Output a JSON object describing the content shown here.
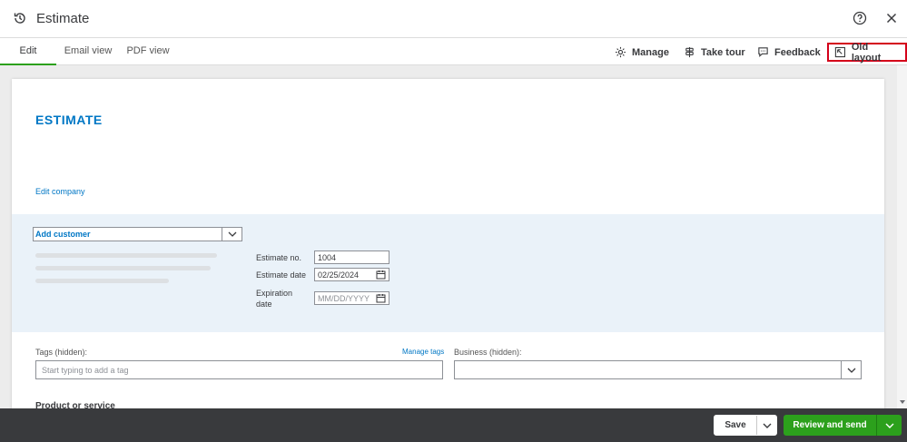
{
  "header": {
    "title": "Estimate"
  },
  "tabs": [
    {
      "label": "Edit",
      "active": true
    },
    {
      "label": "Email view"
    },
    {
      "label": "PDF view"
    }
  ],
  "toolbar": {
    "manage": "Manage",
    "take_tour": "Take tour",
    "feedback": "Feedback",
    "old_layout": "Old layout"
  },
  "form": {
    "heading": "ESTIMATE",
    "edit_company": "Edit company",
    "customer_value": "Add customer",
    "estimate_no_label": "Estimate no.",
    "estimate_no": "1004",
    "estimate_date_label": "Estimate date",
    "estimate_date": "02/25/2024",
    "expiration_label_1": "Expiration",
    "expiration_label_2": "date",
    "expiration_placeholder": "MM/DD/YYYY",
    "tags_label": "Tags (hidden):",
    "manage_tags": "Manage tags",
    "tags_placeholder": "Start typing to add a tag",
    "business_label": "Business (hidden):",
    "product_section": "Product or service"
  },
  "footer": {
    "save": "Save",
    "review_send": "Review and send"
  },
  "colors": {
    "accent_green": "#2ca01c",
    "link_blue": "#0077c5",
    "highlight_red": "#d4001a",
    "footer_dark": "#393a3d"
  }
}
